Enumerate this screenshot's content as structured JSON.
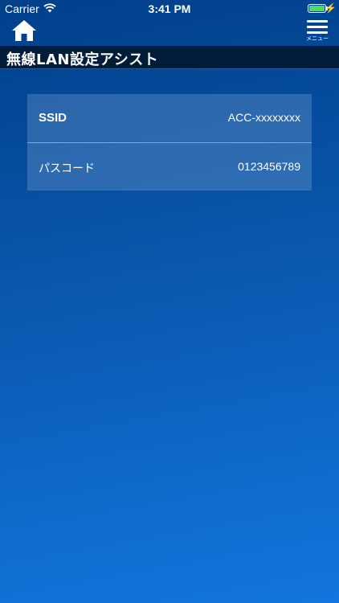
{
  "status_bar": {
    "carrier": "Carrier",
    "time": "3:41 PM",
    "battery_level": 1.0,
    "wifi_icon": "wifi-icon",
    "charging_icon": "bolt-icon"
  },
  "nav": {
    "home_icon": "home-icon",
    "menu_icon": "hamburger-menu-icon",
    "menu_label": "メニュー"
  },
  "header": {
    "title": "無線LAN設定アシスト"
  },
  "settings": {
    "rows": [
      {
        "label": "SSID",
        "value": "ACC-xxxxxxxx"
      },
      {
        "label": "パスコード",
        "value": "0123456789"
      }
    ]
  },
  "colors": {
    "background_top": "#003f8a",
    "background_bottom": "#1276de",
    "title_bar": "#001c3a",
    "battery": "#4cd964"
  }
}
